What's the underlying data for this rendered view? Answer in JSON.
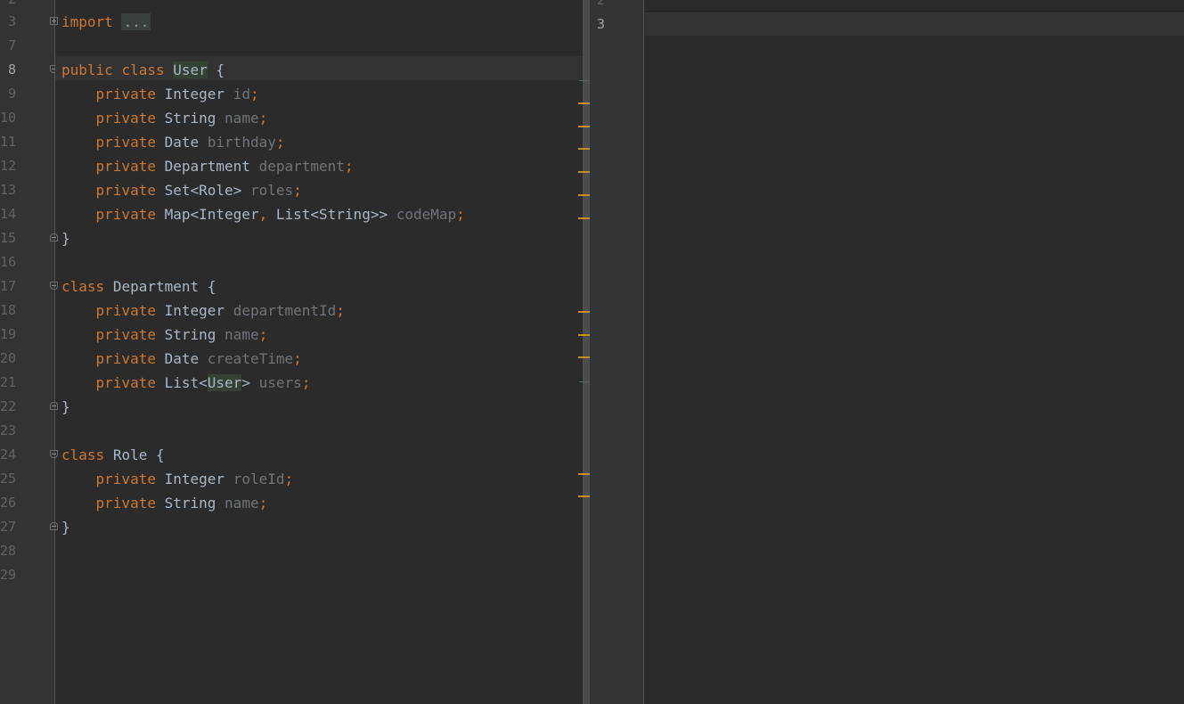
{
  "left_editor": {
    "gutter": {
      "partial_top": "2",
      "lines": [
        "3",
        "7",
        "8",
        "9",
        "10",
        "11",
        "12",
        "13",
        "14",
        "15",
        "16",
        "17",
        "18",
        "19",
        "20",
        "21",
        "22",
        "23",
        "24",
        "25",
        "26",
        "27",
        "28",
        "29"
      ],
      "current": "8"
    },
    "code": {
      "l3": {
        "kw": "import",
        "fold_placeholder": "..."
      },
      "l8": {
        "kw1": "public",
        "kw2": "class",
        "name": "User",
        "brace": "{"
      },
      "l9": {
        "mod": "private",
        "type": "Integer",
        "field": "id",
        "semi": ";"
      },
      "l10": {
        "mod": "private",
        "type": "String",
        "field": "name",
        "semi": ";"
      },
      "l11": {
        "mod": "private",
        "type": "Date",
        "field": "birthday",
        "semi": ";"
      },
      "l12": {
        "mod": "private",
        "type": "Department",
        "field": "department",
        "semi": ";"
      },
      "l13": {
        "mod": "private",
        "type": "Set<Role>",
        "field": "roles",
        "semi": ";"
      },
      "l14": {
        "mod": "private",
        "type1": "Map<Integer",
        "comma": ",",
        "type2": "List<String>>",
        "field": "codeMap",
        "semi": ";"
      },
      "l15": {
        "brace": "}"
      },
      "l17": {
        "kw": "class",
        "name": "Department",
        "brace": "{"
      },
      "l18": {
        "mod": "private",
        "type": "Integer",
        "field": "departmentId",
        "semi": ";"
      },
      "l19": {
        "mod": "private",
        "type": "String",
        "field": "name",
        "semi": ";"
      },
      "l20": {
        "mod": "private",
        "type": "Date",
        "field": "createTime",
        "semi": ";"
      },
      "l21": {
        "mod": "private",
        "type_pre": "List<",
        "type_hl": "User",
        "type_post": ">",
        "field": "users",
        "semi": ";"
      },
      "l22": {
        "brace": "}"
      },
      "l24": {
        "kw": "class",
        "name": "Role",
        "brace": "{"
      },
      "l25": {
        "mod": "private",
        "type": "Integer",
        "field": "roleId",
        "semi": ";"
      },
      "l26": {
        "mod": "private",
        "type": "String",
        "field": "name",
        "semi": ";"
      },
      "l27": {
        "brace": "}"
      }
    }
  },
  "right_editor": {
    "gutter": {
      "partial_top": "2",
      "line3": "3",
      "current": "3"
    }
  },
  "colors": {
    "background": "#2b2b2b",
    "gutter": "#313335",
    "keyword": "#cc7832",
    "identifier": "#a9b7c6",
    "unused_field": "#6f737a",
    "usage_highlight": "#344134",
    "warning_stripe": "#be9117"
  }
}
